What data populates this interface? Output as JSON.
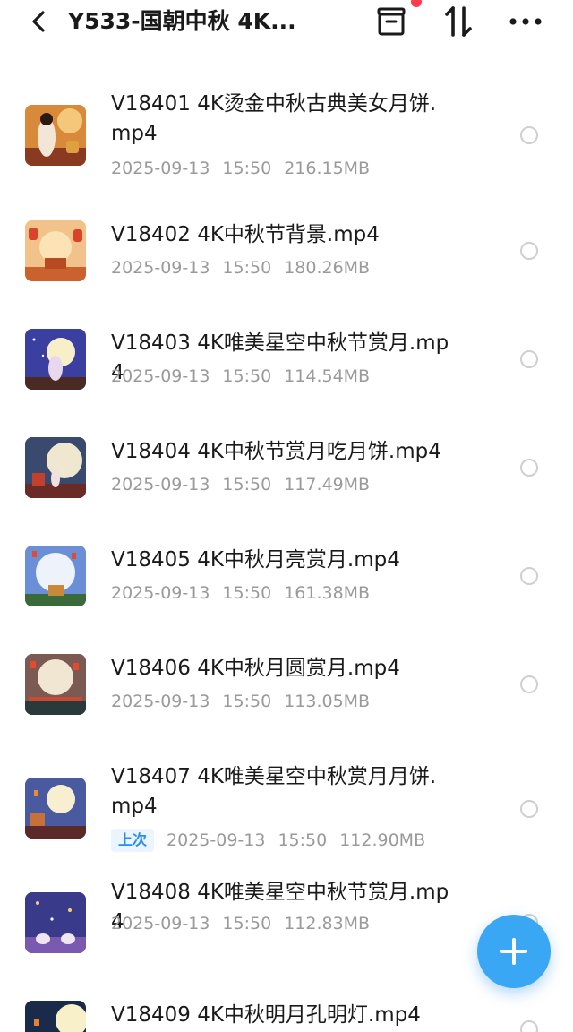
{
  "header": {
    "title": "Y533-国朝中秋 4K...",
    "back_icon": "chevron-left-icon",
    "archive_icon": "archive-box-icon",
    "sort_icon": "sort-arrows-icon",
    "more_icon": "more-dots-icon",
    "notification_color": "#ff3b4e"
  },
  "files": [
    {
      "name": "V18401 4K烫金中秋古典美女月饼.mp4",
      "date": "2025-09-13",
      "time": "15:50",
      "size": "216.15MB",
      "badge": ""
    },
    {
      "name": "V18402 4K中秋节背景.mp4",
      "date": "2025-09-13",
      "time": "15:50",
      "size": "180.26MB",
      "badge": ""
    },
    {
      "name": "V18403 4K唯美星空中秋节赏月.mp4",
      "date": "2025-09-13",
      "time": "15:50",
      "size": "114.54MB",
      "badge": ""
    },
    {
      "name": "V18404 4K中秋节赏月吃月饼.mp4",
      "date": "2025-09-13",
      "time": "15:50",
      "size": "117.49MB",
      "badge": ""
    },
    {
      "name": "V18405 4K中秋月亮赏月.mp4",
      "date": "2025-09-13",
      "time": "15:50",
      "size": "161.38MB",
      "badge": ""
    },
    {
      "name": "V18406 4K中秋月圆赏月.mp4",
      "date": "2025-09-13",
      "time": "15:50",
      "size": "113.05MB",
      "badge": ""
    },
    {
      "name": "V18407 4K唯美星空中秋赏月月饼.mp4",
      "date": "2025-09-13",
      "time": "15:50",
      "size": "112.90MB",
      "badge": "上次"
    },
    {
      "name": "V18408 4K唯美星空中秋节赏月.mp4",
      "date": "2025-09-13",
      "time": "15:50",
      "size": "112.83MB",
      "badge": ""
    },
    {
      "name": "V18409 4K中秋明月孔明灯.mp4",
      "date": "",
      "time": "",
      "size": "",
      "badge": ""
    }
  ],
  "fab": {
    "icon": "plus-icon",
    "color": "#3aa7f5"
  },
  "colors": {
    "accent": "#2a8cf0",
    "meta_text": "#9a9a9a"
  }
}
